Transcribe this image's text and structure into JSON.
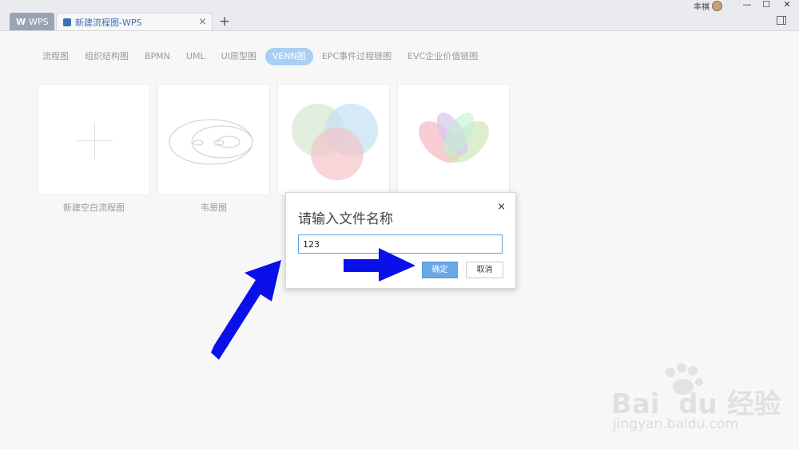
{
  "titlebar": {
    "home_tab": "WPS",
    "doc_tab": "新建流程图-WPS",
    "doc_tab_close": "×",
    "new_tab": "+",
    "user_name": "丰祺",
    "minimize": "—",
    "maximize": "☐",
    "close": "✕"
  },
  "nav": {
    "items": [
      "流程图",
      "组织结构图",
      "BPMN",
      "UML",
      "UI原型图",
      "VENN图",
      "EPC事件过程链图",
      "EVC企业价值链图"
    ],
    "active_index": 5
  },
  "templates": [
    {
      "label": "新建空白流程图"
    },
    {
      "label": "韦恩图"
    },
    {
      "label": ""
    },
    {
      "label": ""
    }
  ],
  "dialog": {
    "title": "请输入文件名称",
    "close": "×",
    "input_value": "123",
    "ok_label": "确定",
    "cancel_label": "取消"
  },
  "watermark": {
    "brand": "Bai  du 经验",
    "url": "jingyan.baidu.com"
  },
  "colors": {
    "accent": "#a9cff3",
    "primary_button": "#6ba6e8",
    "arrow": "#0a10e8"
  }
}
